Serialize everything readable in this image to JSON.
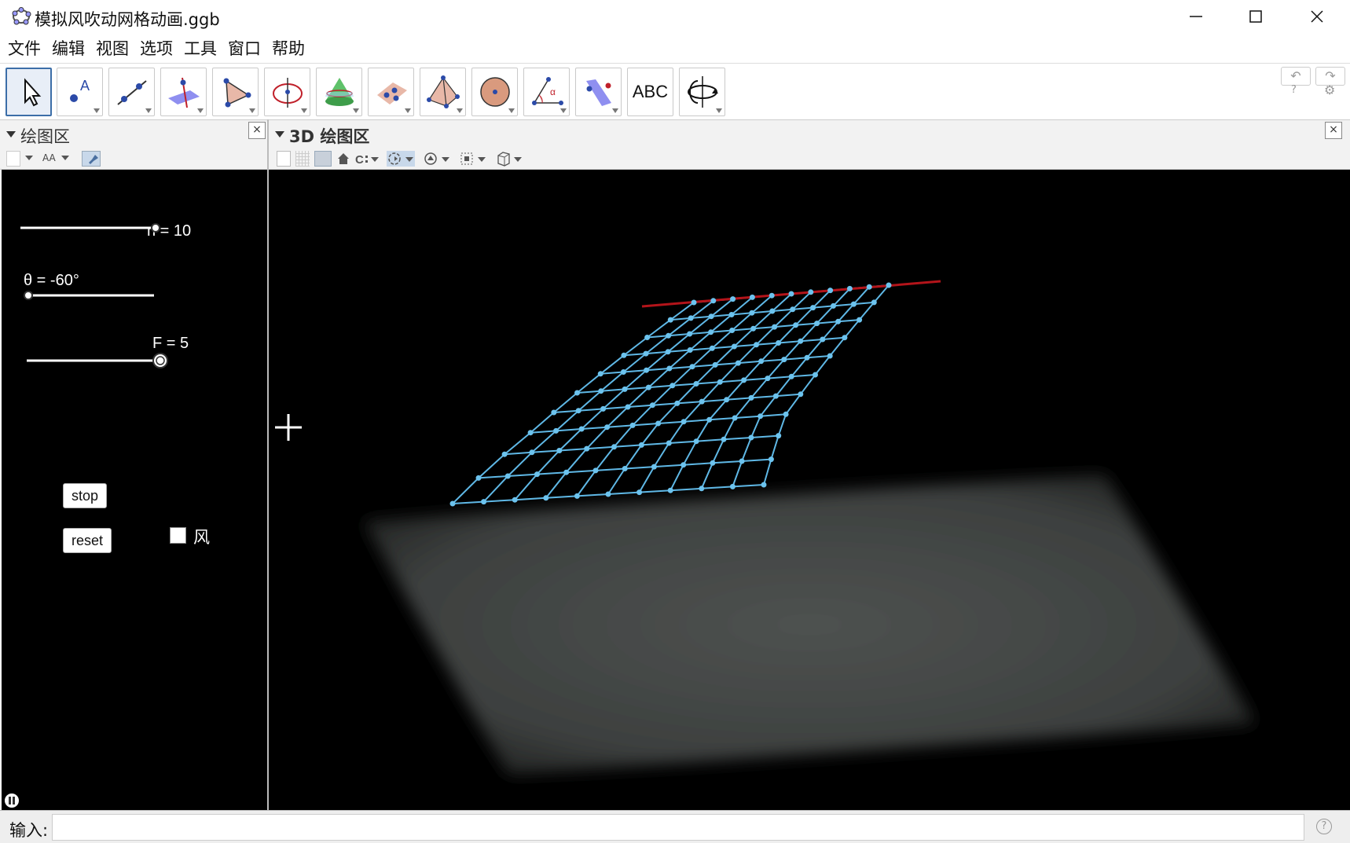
{
  "window": {
    "title": "模拟风吹动网格动画.ggb",
    "minimize_icon": "minimize-icon",
    "maximize_icon": "maximize-icon",
    "close_icon": "close-icon"
  },
  "menu": [
    "文件",
    "编辑",
    "视图",
    "选项",
    "工具",
    "窗口",
    "帮助"
  ],
  "toolbar": {
    "tools": [
      {
        "name": "move-tool",
        "icon": "arrow-cursor-icon"
      },
      {
        "name": "point-tool",
        "icon": "point-a-icon"
      },
      {
        "name": "line-tool",
        "icon": "line-icon"
      },
      {
        "name": "perpendicular-tool",
        "icon": "perpendicular-line-icon"
      },
      {
        "name": "polygon-tool",
        "icon": "triangle-icon"
      },
      {
        "name": "circle-axis-tool",
        "icon": "circle-axis-icon"
      },
      {
        "name": "intersect-surfaces-tool",
        "icon": "cone-icon"
      },
      {
        "name": "plane-points-tool",
        "icon": "plane-points-icon"
      },
      {
        "name": "pyramid-tool",
        "icon": "pyramid-icon"
      },
      {
        "name": "sphere-tool",
        "icon": "sphere-icon"
      },
      {
        "name": "angle-tool",
        "icon": "angle-icon"
      },
      {
        "name": "reflect-tool",
        "icon": "reflect-plane-icon"
      },
      {
        "name": "text-tool",
        "icon": "text-abc-icon",
        "label": "ABC"
      },
      {
        "name": "rotate-view-tool",
        "icon": "rotate-3d-icon"
      }
    ],
    "undo_icon": "↶",
    "redo_icon": "↷",
    "help_icon": "?",
    "settings_icon": "⚙"
  },
  "left_panel": {
    "title": "绘图区",
    "close_icon": "×",
    "style_font_label": "AA"
  },
  "right_panel": {
    "title": "3D 绘图区",
    "close_icon": "×"
  },
  "sliders": [
    {
      "label": "n = 10",
      "value": 10,
      "fraction": 1.0
    },
    {
      "label": "θ = -60°",
      "value": -60,
      "fraction": 0.0
    },
    {
      "label": "F = 5",
      "value": 5,
      "fraction": 1.0
    }
  ],
  "buttons": {
    "stop": "stop",
    "reset": "reset"
  },
  "checkbox": {
    "label": "风",
    "checked": false
  },
  "input_bar": {
    "label": "输入:",
    "value": "",
    "help_icon": "?"
  },
  "colors": {
    "grid": "#5fb8e6",
    "grid_point": "#6cc3ee",
    "anchor_line": "#b3141a",
    "ground": "#4a4d4c",
    "canvas": "#000000"
  }
}
